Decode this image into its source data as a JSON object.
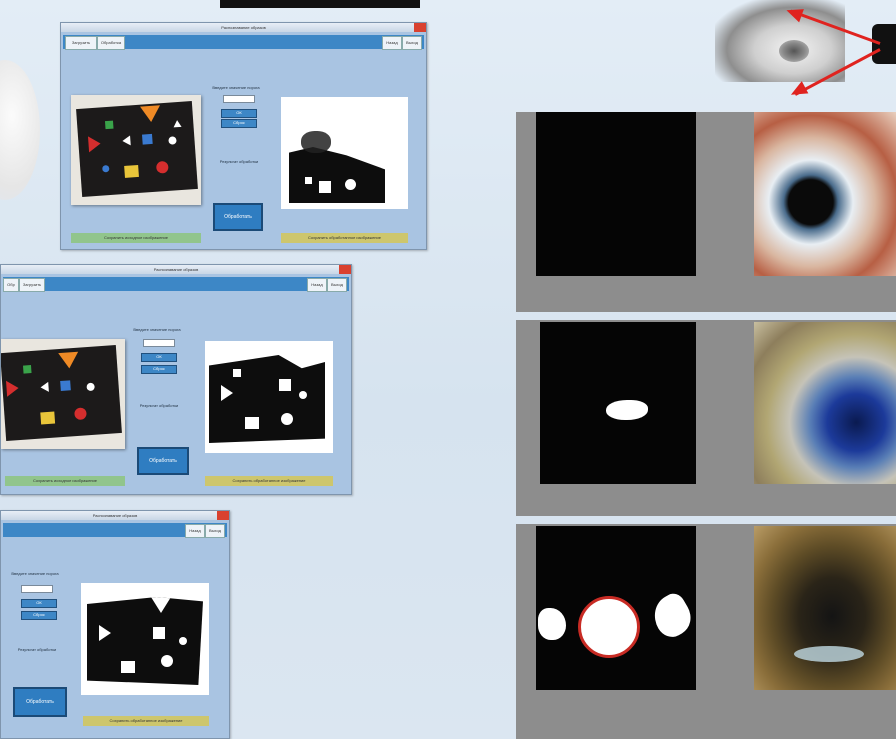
{
  "windows": [
    {
      "title": "Распознавание образов",
      "tab_left_1": "Загрузить",
      "tab_left_2": "Обработка",
      "tab_right_1": "Назад",
      "tab_right_2": "Выход",
      "threshold_label": "Введите значение порога",
      "ok_label": "ОК",
      "cancel_label": "Сброс",
      "process_label": "Обработать",
      "save_original": "Сохранить исходное изображение",
      "save_processed": "Сохранить обработанное изображение",
      "result_label": "Результат обработки"
    },
    {
      "title": "Распознавание образов",
      "tab_left_1": "Обр",
      "tab_left_2": "Загрузить",
      "tab_right_1": "Назад",
      "tab_right_2": "Выход",
      "threshold_label": "Введите значение порога",
      "ok_label": "ОК",
      "cancel_label": "Сброс",
      "process_label": "Обработать",
      "save_original": "Сохранить исходное изображение",
      "save_processed": "Сохранить обработанное изображение",
      "result_label": "Результат обработки"
    },
    {
      "title": "Распознавание образов",
      "tab_right_1": "Назад",
      "tab_right_2": "Выход",
      "threshold_label": "Введите значение порога",
      "ok_label": "ОК",
      "cancel_label": "Сброс",
      "process_label": "Обработать",
      "save_processed": "Сохранить обработанное изображение",
      "result_label": "Результат обработки"
    }
  ],
  "colors": {
    "toolbar": "#3d87c6",
    "window_bg": "#a9c4e2",
    "save_green": "#91c58c",
    "save_yellow": "#cdc66d",
    "arrow": "#e0231f",
    "panel_gray": "#8d8d8d"
  },
  "icons": {
    "eye": "eye-photo",
    "arrow": "red-arrow"
  }
}
